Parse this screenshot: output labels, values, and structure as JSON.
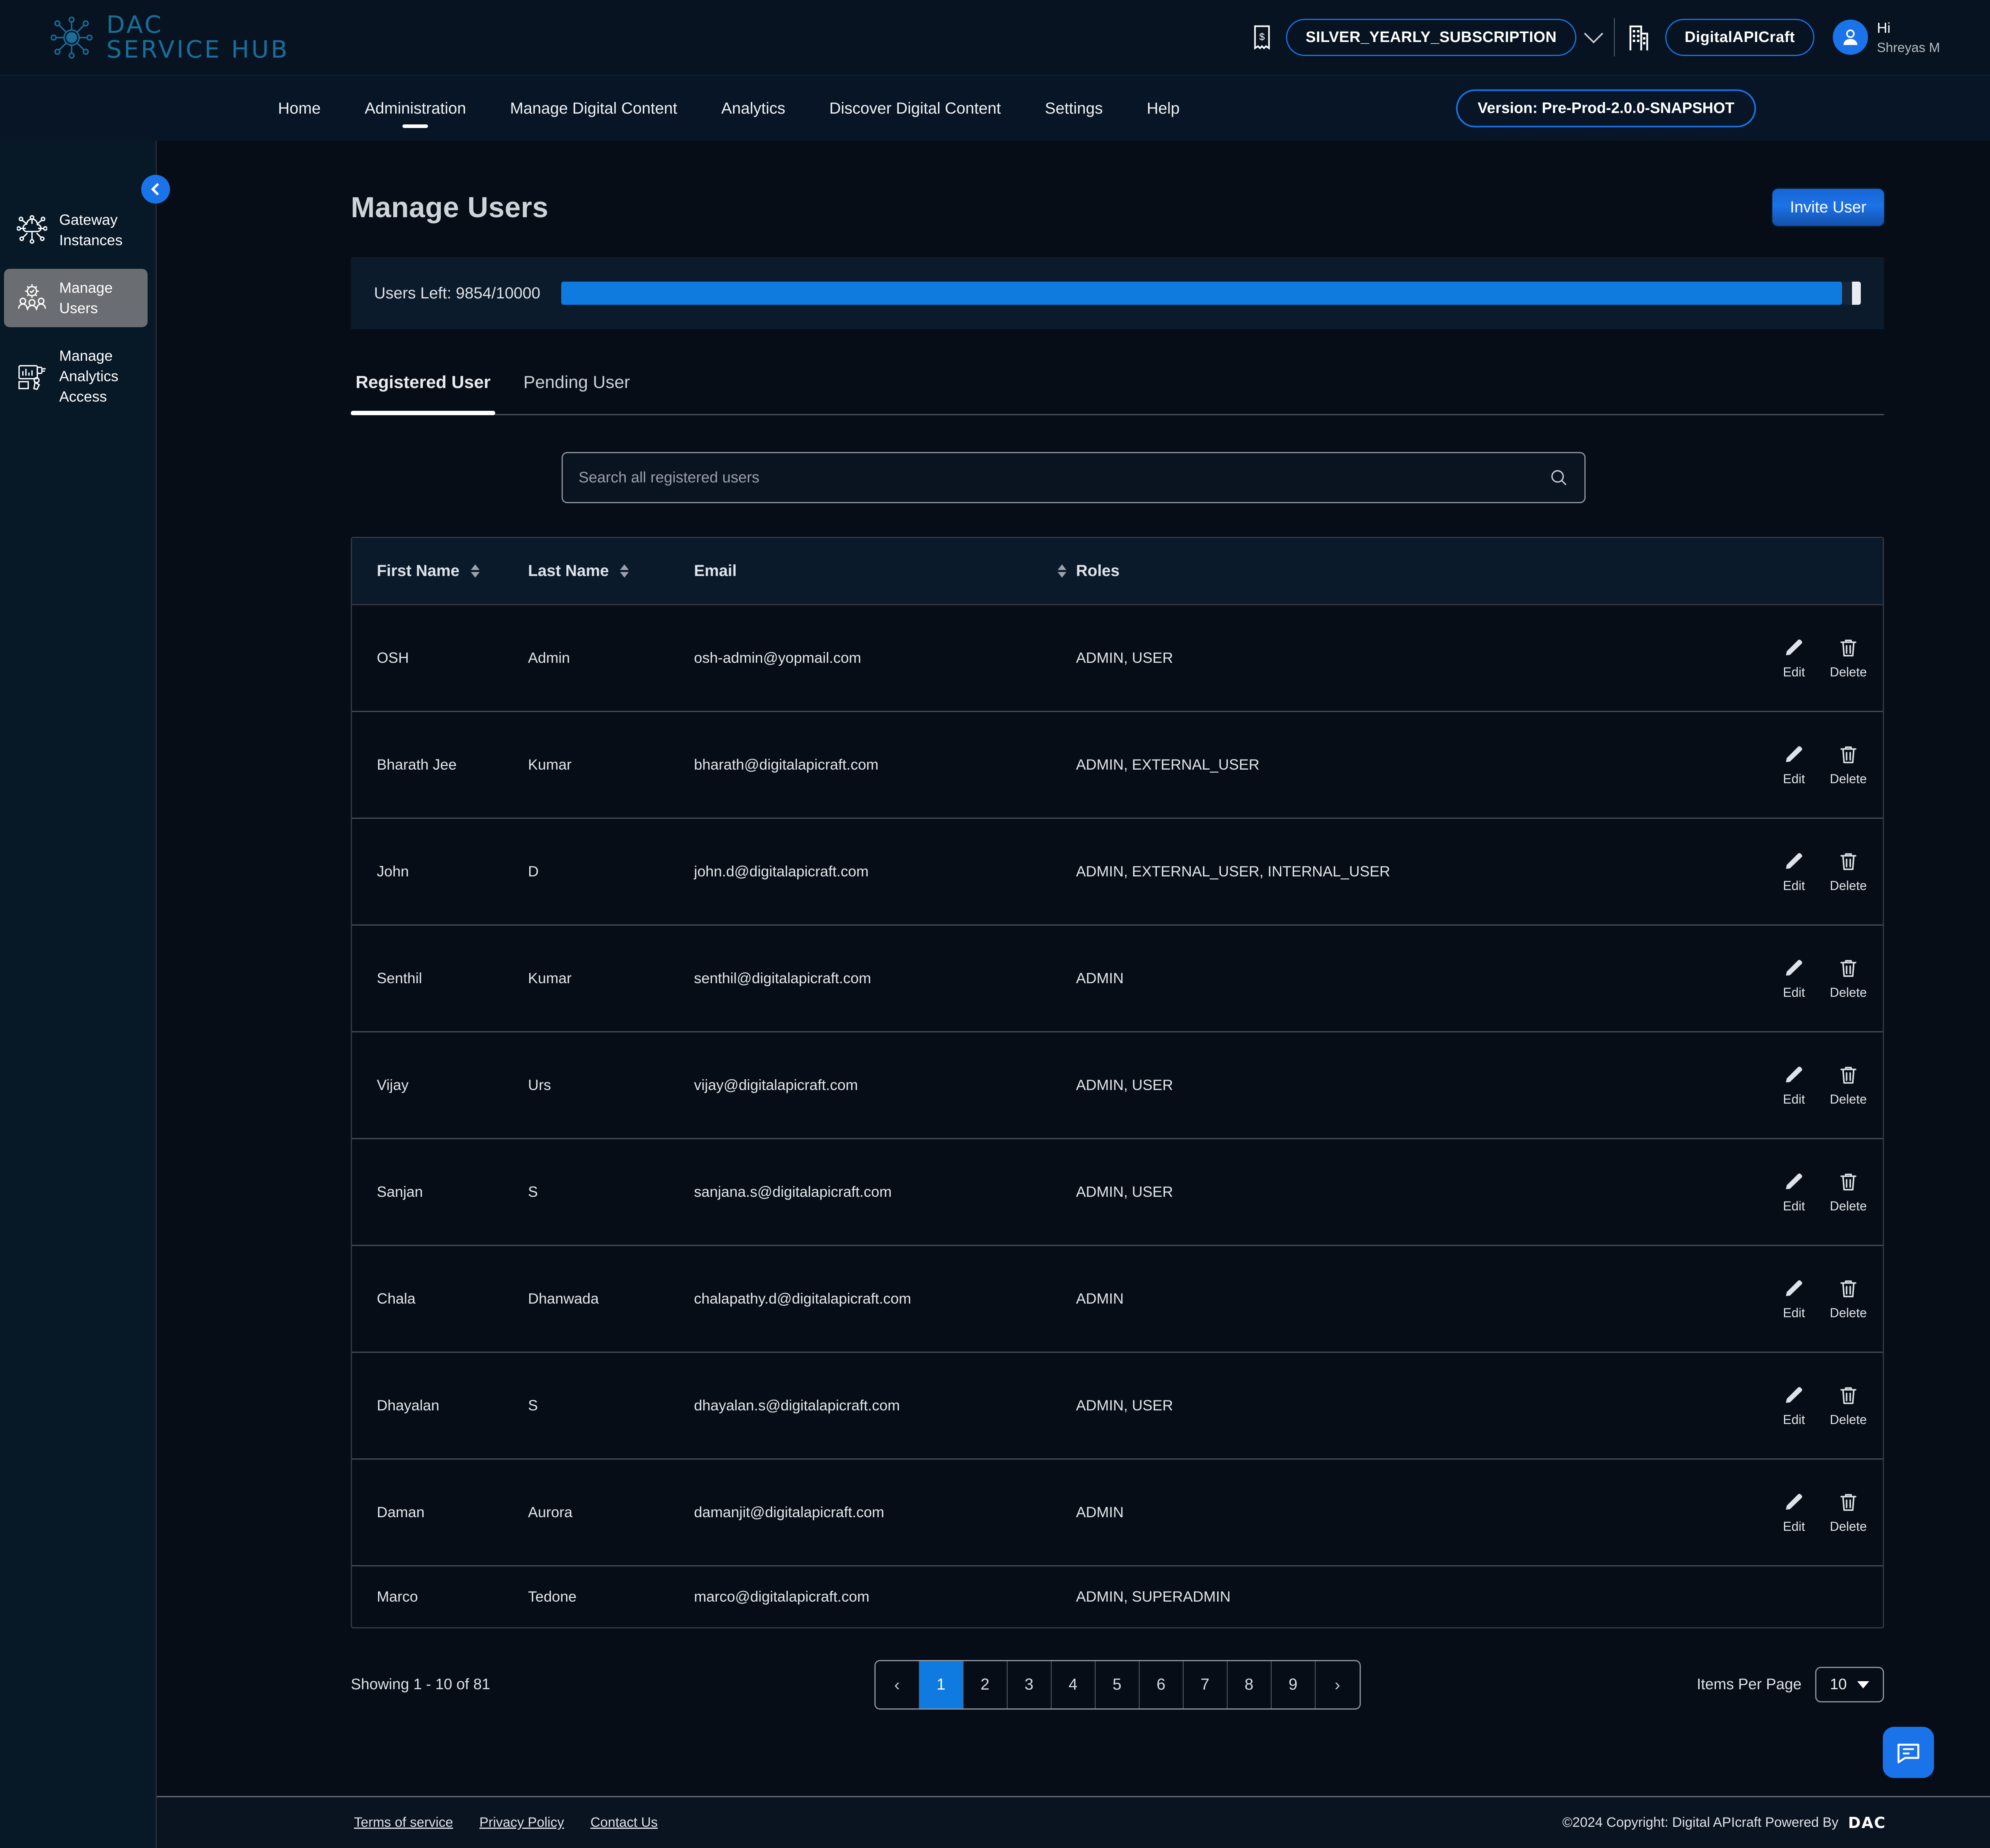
{
  "brand": {
    "line1": "DAC",
    "line2": "SERVICE HUB"
  },
  "header": {
    "subscription": "SILVER_YEARLY_SUBSCRIPTION",
    "organization": "DigitalAPICraft",
    "greeting": "Hi",
    "user_name": "Shreyas M"
  },
  "nav": {
    "items": [
      {
        "label": "Home",
        "active": false
      },
      {
        "label": "Administration",
        "active": true
      },
      {
        "label": "Manage Digital Content",
        "active": false
      },
      {
        "label": "Analytics",
        "active": false
      },
      {
        "label": "Discover Digital Content",
        "active": false
      },
      {
        "label": "Settings",
        "active": false
      },
      {
        "label": "Help",
        "active": false
      }
    ],
    "version": "Version: Pre-Prod-2.0.0-SNAPSHOT"
  },
  "sidebar": {
    "items": [
      {
        "label": "Gateway Instances",
        "active": false
      },
      {
        "label": "Manage Users",
        "active": true
      },
      {
        "label": "Manage Analytics Access",
        "active": false
      }
    ]
  },
  "page": {
    "title": "Manage Users",
    "invite_label": "Invite User",
    "users_left_label": "Users Left: 9854/10000",
    "users_left_current": 9854,
    "users_left_total": 10000,
    "progress_percent": 98.54
  },
  "tabs": [
    {
      "label": "Registered User",
      "active": true
    },
    {
      "label": "Pending User",
      "active": false
    }
  ],
  "search": {
    "placeholder": "Search all registered users",
    "value": ""
  },
  "table": {
    "columns": [
      {
        "label": "First Name",
        "sortable": true
      },
      {
        "label": "Last Name",
        "sortable": true
      },
      {
        "label": "Email",
        "sortable": true
      },
      {
        "label": "Roles",
        "sortable": false
      }
    ],
    "edit_label": "Edit",
    "delete_label": "Delete",
    "rows": [
      {
        "first": "OSH",
        "last": "Admin",
        "email": "osh-admin@yopmail.com",
        "roles": "ADMIN, USER"
      },
      {
        "first": "Bharath Jee",
        "last": "Kumar",
        "email": "bharath@digitalapicraft.com",
        "roles": "ADMIN, EXTERNAL_USER"
      },
      {
        "first": "John",
        "last": "D",
        "email": "john.d@digitalapicraft.com",
        "roles": "ADMIN, EXTERNAL_USER, INTERNAL_USER"
      },
      {
        "first": "Senthil",
        "last": "Kumar",
        "email": "senthil@digitalapicraft.com",
        "roles": "ADMIN"
      },
      {
        "first": "Vijay",
        "last": "Urs",
        "email": "vijay@digitalapicraft.com",
        "roles": "ADMIN, USER"
      },
      {
        "first": "Sanjan",
        "last": "S",
        "email": "sanjana.s@digitalapicraft.com",
        "roles": "ADMIN, USER"
      },
      {
        "first": "Chala",
        "last": "Dhanwada",
        "email": "chalapathy.d@digitalapicraft.com",
        "roles": "ADMIN"
      },
      {
        "first": "Dhayalan",
        "last": "S",
        "email": "dhayalan.s@digitalapicraft.com",
        "roles": "ADMIN, USER"
      },
      {
        "first": "Daman",
        "last": "Aurora",
        "email": "damanjit@digitalapicraft.com",
        "roles": "ADMIN"
      },
      {
        "first": "Marco",
        "last": "Tedone",
        "email": "marco@digitalapicraft.com",
        "roles": "ADMIN, SUPERADMIN"
      }
    ]
  },
  "pagination": {
    "showing": "Showing 1 - 10 of 81",
    "prev": "‹",
    "next": "›",
    "pages": [
      "1",
      "2",
      "3",
      "4",
      "5",
      "6",
      "7",
      "8",
      "9"
    ],
    "current_page": "1",
    "items_per_page_label": "Items Per Page",
    "items_per_page_value": "10"
  },
  "footer": {
    "links": [
      "Terms of service",
      "Privacy Policy",
      "Contact Us"
    ],
    "copyright": "©2024 Copyright: Digital APIcraft Powered By",
    "logo_text": "DAC"
  },
  "colors": {
    "accent": "#1a73e8",
    "brand": "#1a6e99",
    "progress": "#0f7ae0"
  }
}
